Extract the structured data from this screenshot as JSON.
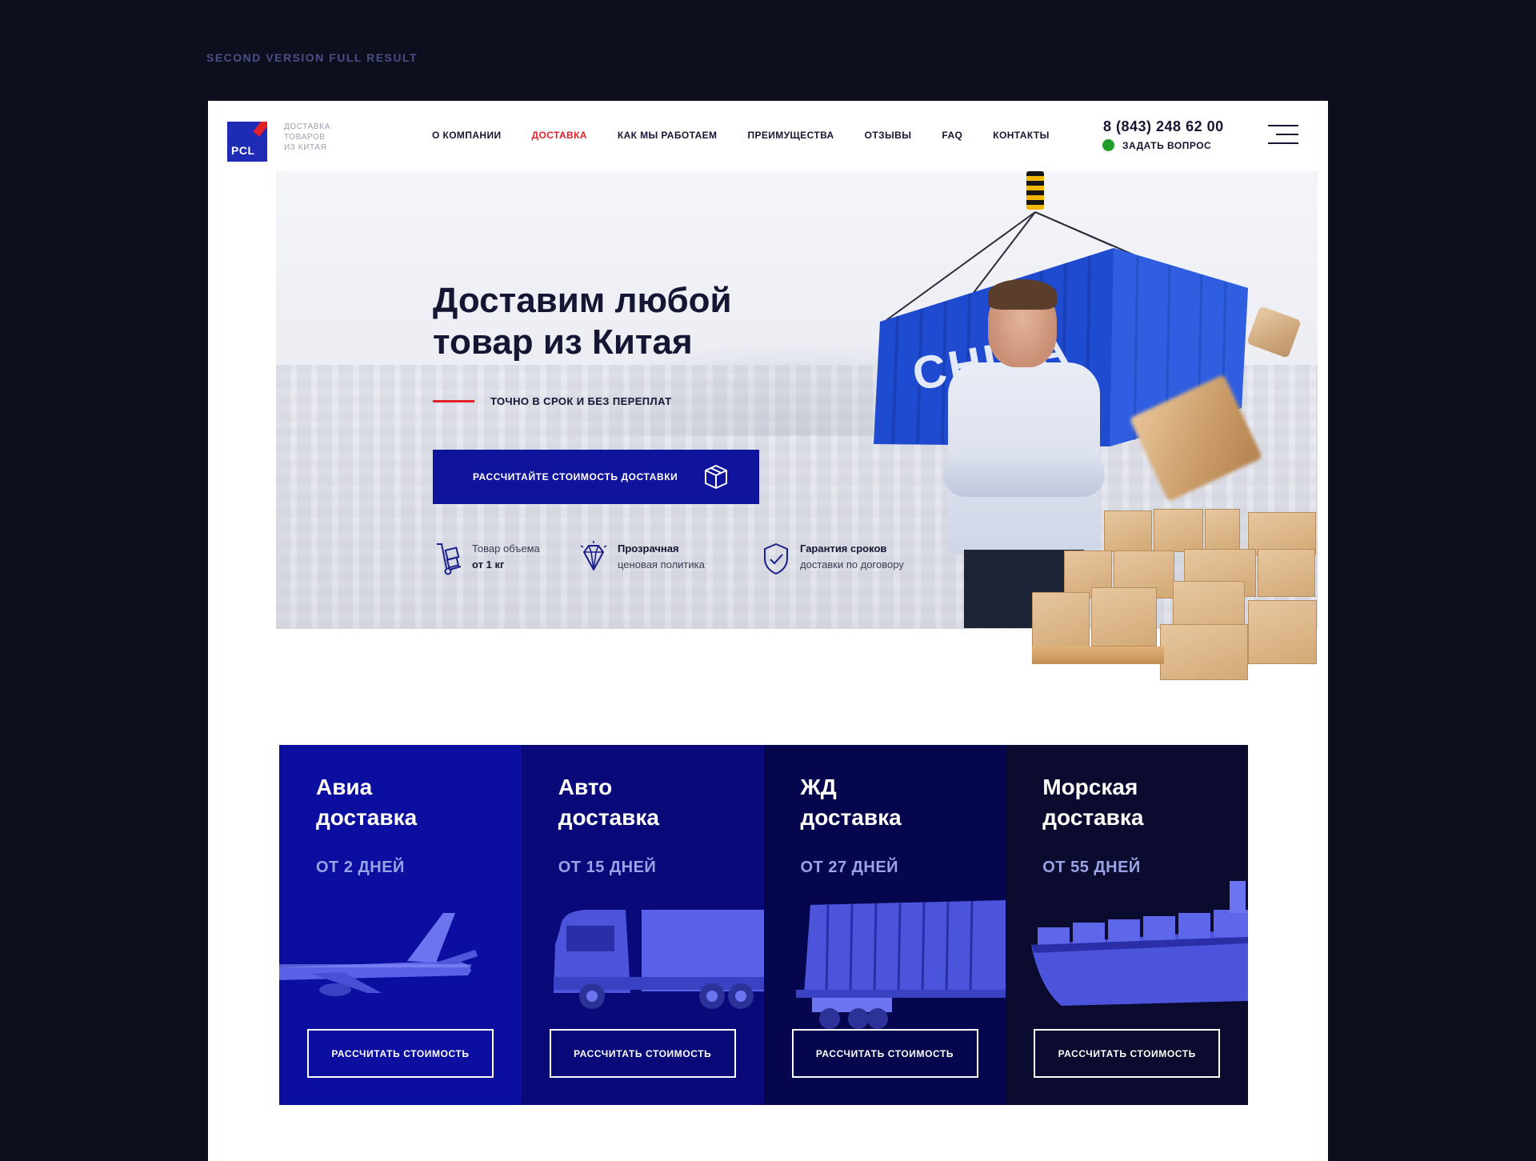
{
  "caption": "SECOND VERSION FULL RESULT",
  "header": {
    "logo_text": "PCL",
    "tagline": [
      "ДОСТАВКА",
      "ТОВАРОВ",
      "ИЗ КИТАЯ"
    ],
    "nav": [
      {
        "label": "О КОМПАНИИ",
        "active": false
      },
      {
        "label": "ДОСТАВКА",
        "active": true
      },
      {
        "label": "КАК МЫ РАБОТАЕМ",
        "active": false
      },
      {
        "label": "ПРЕИМУЩЕСТВА",
        "active": false
      },
      {
        "label": "ОТЗЫВЫ",
        "active": false
      },
      {
        "label": "FAQ",
        "active": false
      },
      {
        "label": "КОНТАКТЫ",
        "active": false
      }
    ],
    "phone": "8 (843) 248 62 00",
    "ask_label": "ЗАДАТЬ ВОПРОС"
  },
  "hero": {
    "title_line1": "Доставим любой",
    "title_line2": "товар из Китая",
    "subtitle": "ТОЧНО В СРОК И БЕЗ ПЕРЕПЛАТ",
    "cta_label": "РАССЧИТАЙТЕ СТОИМОСТЬ ДОСТАВКИ",
    "container_word": "CHINA",
    "features": [
      {
        "icon": "hand-truck-icon",
        "line1": "Товар объема",
        "line2": "от 1 кг",
        "bold_line": 2
      },
      {
        "icon": "diamond-icon",
        "line1": "Прозрачная",
        "line2": "ценовая политика",
        "bold_line": 1
      },
      {
        "icon": "shield-check-icon",
        "line1": "Гарантия сроков",
        "line2": "доставки по договору",
        "bold_line": 1
      }
    ]
  },
  "delivery": [
    {
      "title_line1": "Авиа",
      "title_line2": "доставка",
      "days": "ОТ 2 ДНЕЙ",
      "button": "РАССЧИТАТЬ СТОИМОСТЬ",
      "bg": "#0c0ea0",
      "art": "airplane"
    },
    {
      "title_line1": "Авто",
      "title_line2": "доставка",
      "days": "ОТ 15 ДНЕЙ",
      "button": "РАССЧИТАТЬ СТОИМОСТЬ",
      "bg": "#09097a",
      "art": "truck"
    },
    {
      "title_line1": "ЖД",
      "title_line2": "доставка",
      "days": "ОТ 27 ДНЕЙ",
      "button": "РАССЧИТАТЬ СТОИМОСТЬ",
      "bg": "#06064f",
      "art": "train"
    },
    {
      "title_line1": "Морская",
      "title_line2": "доставка",
      "days": "ОТ 55 ДНЕЙ",
      "button": "РАССЧИТАТЬ СТОИМОСТЬ",
      "bg": "#0a0b2e",
      "art": "ship"
    }
  ],
  "colors": {
    "page_bg": "#0d0f1f",
    "brand_blue": "#10139b",
    "accent_red": "#e3202a",
    "online_green": "#1f9e2c"
  }
}
